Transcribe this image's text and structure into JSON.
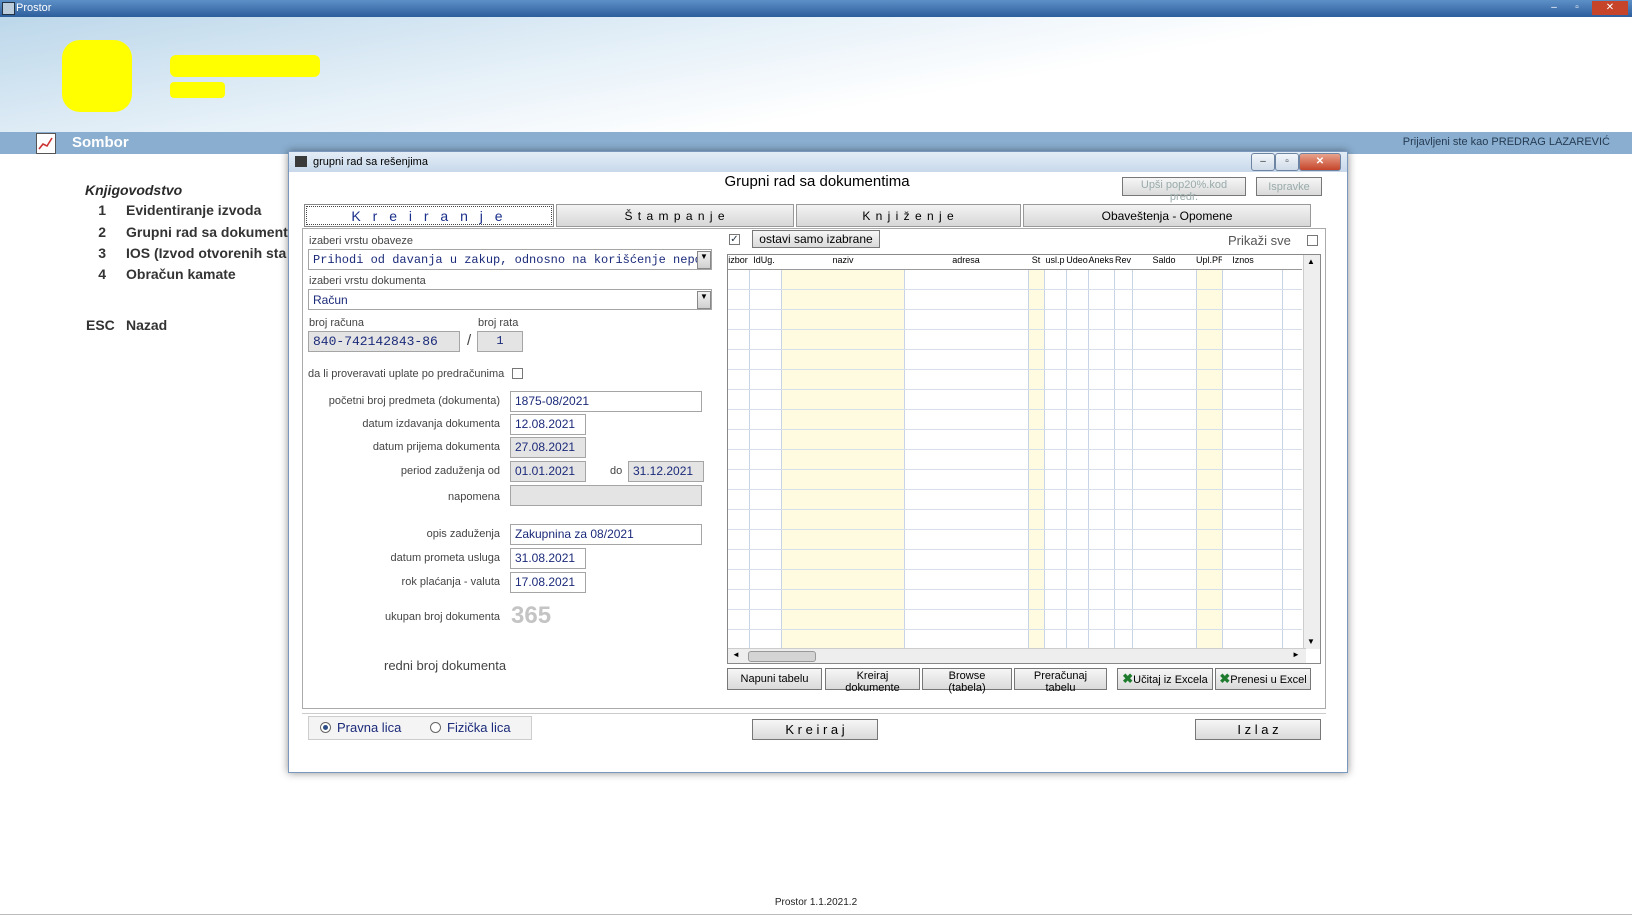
{
  "window": {
    "title": "Prostor",
    "minimize": "–",
    "restore": "▫",
    "close": "✕"
  },
  "header": {
    "city": "Sombor",
    "user_text": "Prijavljeni ste kao PREDRAG LAZAREVIĆ"
  },
  "menu": {
    "title": "Knjigovodstvo",
    "items": [
      {
        "num": "1",
        "label": "Evidentiranje izvoda"
      },
      {
        "num": "2",
        "label": "Grupni rad sa dokument"
      },
      {
        "num": "3",
        "label": "IOS (Izvod otvorenih sta"
      },
      {
        "num": "4",
        "label": "Obračun kamate"
      }
    ],
    "esc": {
      "num": "ESC",
      "label": "Nazad"
    }
  },
  "dialog": {
    "title": "grupni rad sa rešenjima",
    "heading": "Grupni rad sa dokumentima",
    "btn_upsi": "Upši pop20%.kod predr.",
    "btn_ispravke": "Ispravke",
    "tabs": [
      "K r e i r a n j e",
      "Š t a m p a n j e",
      "K n j i ž e n j e",
      "Obaveštenja - Opomene"
    ],
    "form": {
      "obaveza_label": "izaberi vrstu obaveze",
      "obaveza_value": "Prihodi od davanja u zakup, odnosno na korišćenje nepokre",
      "dokument_label": "izaberi vrstu dokumenta",
      "dokument_value": "Račun",
      "racun_label": "broj računa",
      "racun_value": "840-742142843-86",
      "rata_label": "broj rata",
      "rata_value": "1",
      "slash": "/",
      "proveravati_label": "da li proveravati uplate po predračunima",
      "pocetni_label": "početni broj predmeta (dokumenta)",
      "pocetni_value": "1875-08/2021",
      "izdavanja_label": "datum izdavanja dokumenta",
      "izdavanja_value": "12.08.2021",
      "prijema_label": "datum prijema dokumenta",
      "prijema_value": "27.08.2021",
      "period_label": "period zaduženja  od",
      "period_od": "01.01.2021",
      "period_do_label": "do",
      "period_do": "31.12.2021",
      "napomena_label": "napomena",
      "napomena_value": "",
      "opis_label": "opis zaduženja",
      "opis_value": "Zakupnina za 08/2021",
      "prometa_label": "datum prometa usluga",
      "prometa_value": "31.08.2021",
      "rok_label": "rok plaćanja - valuta",
      "rok_value": "17.08.2021",
      "ukupan_label": "ukupan broj dokumenta",
      "ukupan_value": "365",
      "redni_label": "redni broj dokumenta"
    },
    "grid": {
      "btn_ostavi": "ostavi samo izabrane",
      "prikazi_label": "Prikaži sve",
      "columns": [
        "izbor",
        "IdUg.",
        "naziv",
        "adresa",
        "St",
        "usl.p",
        "Udeo",
        "Aneks",
        "Rev",
        "Saldo",
        "Upl.PR",
        "Iznos"
      ]
    },
    "actions": [
      "Napuni tabelu",
      "Kreiraj dokumente",
      "Browse (tabela)",
      "Preračunaj tabelu",
      "Učitaj iz Excela",
      "Prenesi u Excel"
    ],
    "radio_pravna": "Pravna lica",
    "radio_fizicka": "Fizička lica",
    "btn_kreiraj": "K r e i r a j",
    "btn_izlaz": "I z l a z"
  },
  "footer": {
    "version": "Prostor 1.1.2021.2"
  },
  "colors": {
    "title_blue": "#1b2a7a",
    "city_bar": "#8aaed0",
    "highlight_yellow": "#fffbe1"
  }
}
